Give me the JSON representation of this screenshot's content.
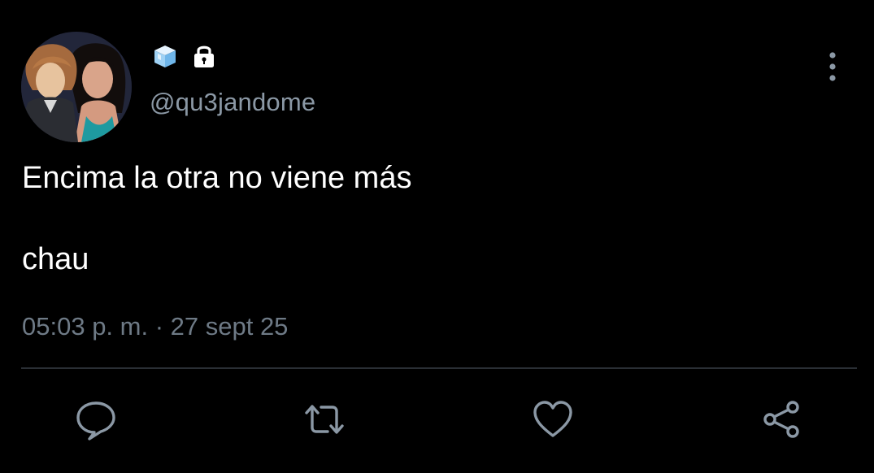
{
  "profile": {
    "handle": "@qu3jandome",
    "name_icons": [
      "ice-cube-emoji",
      "lock-icon"
    ]
  },
  "tweet": {
    "line1": "Encima la otra no viene más",
    "line2": "chau",
    "timestamp": "05:03 p. m. · 27 sept 25"
  },
  "actions": [
    {
      "name": "reply",
      "icon": "reply-icon"
    },
    {
      "name": "retweet",
      "icon": "retweet-icon"
    },
    {
      "name": "like",
      "icon": "heart-icon"
    },
    {
      "name": "share",
      "icon": "share-icon"
    }
  ],
  "colors": {
    "background": "#000000",
    "text": "#ffffff",
    "secondary_text": "#8b98a5",
    "icon": "#8b98a5",
    "divider": "#2a2f35"
  }
}
